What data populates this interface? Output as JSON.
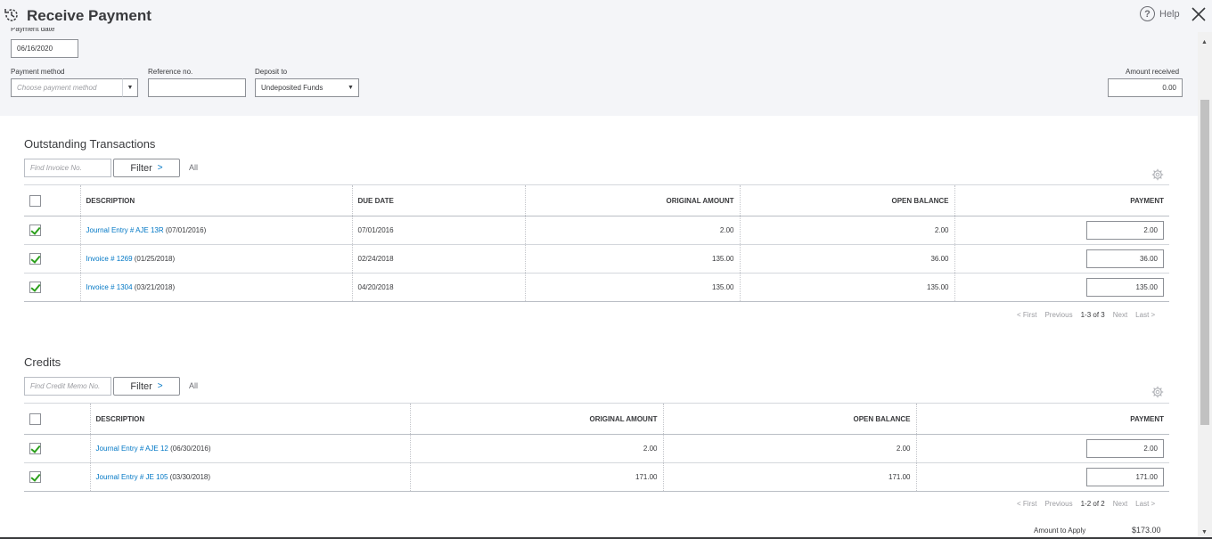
{
  "header": {
    "title": "Receive Payment",
    "help_label": "Help",
    "payment_date_label": "Payment date",
    "payment_date_value": "06/16/2020",
    "payment_method_label": "Payment method",
    "payment_method_placeholder": "Choose payment method",
    "reference_label": "Reference no.",
    "reference_value": "",
    "deposit_label": "Deposit to",
    "deposit_value": "Undeposited Funds",
    "amount_received_label": "Amount received",
    "amount_received_value": "0.00"
  },
  "outstanding": {
    "title": "Outstanding Transactions",
    "search_placeholder": "Find Invoice No.",
    "filter_label": "Filter",
    "all_label": "All",
    "columns": [
      "DESCRIPTION",
      "DUE DATE",
      "ORIGINAL AMOUNT",
      "OPEN BALANCE",
      "PAYMENT"
    ],
    "rows": [
      {
        "checked": true,
        "link": "Journal Entry # AJE 13R",
        "date_suffix": " (07/01/2016)",
        "due": "07/01/2016",
        "original": "2.00",
        "open": "2.00",
        "payment": "2.00"
      },
      {
        "checked": true,
        "link": "Invoice # 1269",
        "date_suffix": " (01/25/2018)",
        "due": "02/24/2018",
        "original": "135.00",
        "open": "36.00",
        "payment": "36.00"
      },
      {
        "checked": true,
        "link": "Invoice # 1304",
        "date_suffix": " (03/21/2018)",
        "due": "04/20/2018",
        "original": "135.00",
        "open": "135.00",
        "payment": "135.00"
      }
    ],
    "pager": {
      "first": "< First",
      "previous": "Previous",
      "range": "1-3 of 3",
      "next": "Next",
      "last": "Last >"
    }
  },
  "credits": {
    "title": "Credits",
    "search_placeholder": "Find Credit Memo No.",
    "filter_label": "Filter",
    "all_label": "All",
    "columns": [
      "DESCRIPTION",
      "ORIGINAL AMOUNT",
      "OPEN BALANCE",
      "PAYMENT"
    ],
    "rows": [
      {
        "checked": true,
        "link": "Journal Entry # AJE 12",
        "date_suffix": " (06/30/2016)",
        "original": "2.00",
        "open": "2.00",
        "payment": "2.00"
      },
      {
        "checked": true,
        "link": "Journal Entry # JE 105",
        "date_suffix": " (03/30/2018)",
        "original": "171.00",
        "open": "171.00",
        "payment": "171.00"
      }
    ],
    "pager": {
      "first": "< First",
      "previous": "Previous",
      "range": "1-2 of 2",
      "next": "Next",
      "last": "Last >"
    }
  },
  "footer": {
    "amount_to_apply_label": "Amount to Apply",
    "amount_to_apply_value": "$173.00"
  },
  "colors": {
    "link": "#0077c5",
    "check": "#2ca01c",
    "header_bg": "#f4f5f8"
  }
}
